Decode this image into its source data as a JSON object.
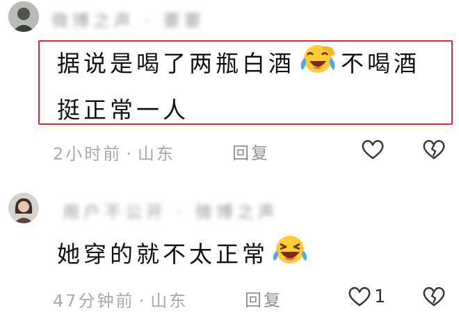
{
  "comments": [
    {
      "username": "微博之声 · 要要",
      "text_line1": "据说是喝了两瓶白酒",
      "emoji1": "face-with-tears-of-joy-icon",
      "text_line1_tail": "不喝酒",
      "text_line2": "挺正常一人",
      "time": "2小时前",
      "location": "山东",
      "reply_label": "回复",
      "like_count": ""
    },
    {
      "username": "用户不公开 · 微博之声",
      "text": "她穿的就不太正常",
      "emoji": "grinning-squinting-tears-icon",
      "time": "47分钟前",
      "location": "山东",
      "reply_label": "回复",
      "like_count": "1"
    }
  ],
  "colors": {
    "highlight_border": "#e5262b",
    "meta_text": "#a8a8a8",
    "emoji_yellow": "#ffcc33"
  }
}
